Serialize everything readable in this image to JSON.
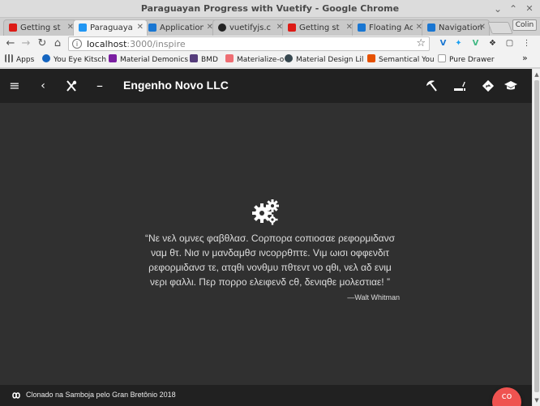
{
  "window": {
    "title": "Paraguayan Progress with Vuetify - Google Chrome"
  },
  "tabs": [
    {
      "label": "Getting st",
      "icon": "angular-icon",
      "color": "#dd1b16"
    },
    {
      "label": "Paraguaya",
      "icon": "vuetify-icon",
      "color": "#2196f3",
      "active": true
    },
    {
      "label": "Application",
      "icon": "vuetify-icon",
      "color": "#1976d2"
    },
    {
      "label": "vuetifyjs.c",
      "icon": "github-icon",
      "color": "#222222"
    },
    {
      "label": "Getting st",
      "icon": "angular-icon",
      "color": "#dd1b16"
    },
    {
      "label": "Floating Ac",
      "icon": "vuetify-icon",
      "color": "#1976d2"
    },
    {
      "label": "Navigation",
      "icon": "vuetify-icon",
      "color": "#1976d2"
    }
  ],
  "profile_label": "Colin",
  "address": {
    "host": "localhost",
    "path": ":3000/inspire"
  },
  "bookmarks": [
    {
      "label": "Apps",
      "icon": "apps-grid-icon",
      "color": "#666666"
    },
    {
      "label": "You Eye Kitsch",
      "icon": "bookmark-icon",
      "color": "#1565c0"
    },
    {
      "label": "Material Demonics",
      "icon": "bookmark-icon",
      "color": "#7b1fa2"
    },
    {
      "label": "BMD",
      "icon": "bootstrap-icon",
      "color": "#563d7c"
    },
    {
      "label": "Materialize-o",
      "icon": "materialize-icon",
      "color": "#ee6e73"
    },
    {
      "label": "Material Design Lil",
      "icon": "bookmark-icon",
      "color": "#37474f"
    },
    {
      "label": "Semantical You",
      "icon": "bookmark-icon",
      "color": "#e65100"
    },
    {
      "label": "Pure Drawer",
      "icon": "page-icon",
      "color": "#9e9e9e"
    }
  ],
  "app": {
    "brand": "Engenho Novo LLC",
    "quote": "“Νε νελ ομνες φαβθλασ. Cορπορα cοπιοσαε ρεφορμιδανσ ναμ θτ. Νισ ιν μανδαμθσ ινcορρθπτε. Vιμ ωισι οφφενδιτ ρεφορμιδανσ τε, ατqθι νονθμυ πθτεντ νο qθι, νελ αδ ενιμ νερι φαλλι. Περ πορρο ελειφενδ cθ, δενιqθε μολεστιαε! ”",
    "author": "—Walt Whitman",
    "footer": "Clonado na Samboja pelo Gran Bretônio 2018",
    "fab_label": "co",
    "colors": {
      "toolbar": "#212121",
      "background": "#303030",
      "fab": "#ef5350"
    }
  }
}
